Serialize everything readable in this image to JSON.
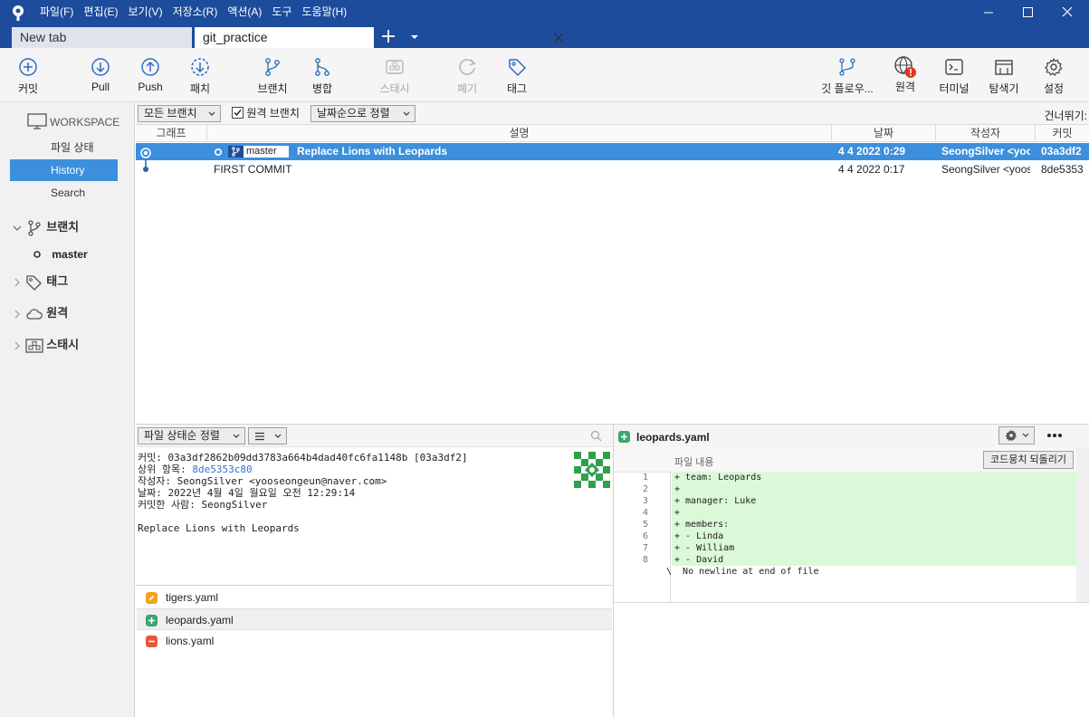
{
  "titlebar": {
    "menu": [
      "파일(F)",
      "편집(E)",
      "보기(V)",
      "저장소(R)",
      "액션(A)",
      "도구",
      "도움말(H)"
    ]
  },
  "tabs": {
    "new_tab": "New tab",
    "repo_tab": "git_practice"
  },
  "toolbar": {
    "commit": "커밋",
    "pull": "Pull",
    "push": "Push",
    "fetch": "패치",
    "branch": "브랜치",
    "merge": "병합",
    "stash": "스태시",
    "discard": "폐기",
    "tag": "태그",
    "git_flow": "깃 플로우...",
    "remote": "원격",
    "terminal": "터미널",
    "explorer": "탐색기",
    "settings": "설정"
  },
  "sidebar": {
    "workspace": "WORKSPACE",
    "file_status": "파일 상태",
    "history": "History",
    "search": "Search",
    "branches": "브랜치",
    "current_branch": "master",
    "tags": "태그",
    "remotes": "원격",
    "stashes": "스태시"
  },
  "filter": {
    "branches": "모든 브랜치",
    "remote_branches": "원격 브랜치",
    "sort": "날짜순으로 정렬",
    "jump": "건너뛰기:"
  },
  "columns": {
    "graph": "그래프",
    "description": "설명",
    "date": "날짜",
    "author": "작성자",
    "commit": "커밋"
  },
  "commits": [
    {
      "branch": "master",
      "message": "Replace Lions with Leopards",
      "date": "4 4 2022 0:29",
      "author": "SeongSilver <yooseongeun@naver.com>",
      "hash": "03a3df2"
    },
    {
      "branch": "",
      "message": "FIRST COMMIT",
      "date": "4 4 2022 0:17",
      "author": "SeongSilver <yooseongeun@naver.com>",
      "hash": "8de5353"
    }
  ],
  "file_pane": {
    "sort": "파일 상태순 정렬"
  },
  "details": {
    "commit_label": "커밋:",
    "commit_value": "03a3df2862b09dd3783a664b4dad40fc6fa1148b [03a3df2]",
    "parent_label": "상위 항목:",
    "parent_value": "8de5353c80",
    "author_label": "작성자:",
    "author_value": "SeongSilver <yooseongeun@naver.com>",
    "date_label": "날짜:",
    "date_value": "2022년 4월 4일 월요일 오전 12:29:14",
    "committer_label": "커밋한 사람:",
    "committer_value": "SeongSilver",
    "message": "Replace Lions with Leopards"
  },
  "files": [
    {
      "name": "tigers.yaml",
      "status": "modified",
      "color": "#f0a21a"
    },
    {
      "name": "leopards.yaml",
      "status": "added",
      "color": "#3aa76d"
    },
    {
      "name": "lions.yaml",
      "status": "removed",
      "color": "#e8553a"
    }
  ],
  "diff": {
    "file": "leopards.yaml",
    "hunk_header": "파일 내용",
    "revert": "코드뭉치 되돌리기",
    "lines": [
      {
        "n": "1",
        "text": "+ team: Leopards"
      },
      {
        "n": "2",
        "text": "+"
      },
      {
        "n": "3",
        "text": "+ manager: Luke"
      },
      {
        "n": "4",
        "text": "+"
      },
      {
        "n": "5",
        "text": "+ members:"
      },
      {
        "n": "6",
        "text": "+ - Linda"
      },
      {
        "n": "7",
        "text": "+ - William"
      },
      {
        "n": "8",
        "text": "+ - David"
      },
      {
        "n": "",
        "text": "\\  No newline at end of file"
      }
    ]
  },
  "colors": {
    "titlebar": "#1d4c9c",
    "selection": "#3c8fdd",
    "added": "#dbf8d8",
    "remote_badge": "#e8321e"
  }
}
